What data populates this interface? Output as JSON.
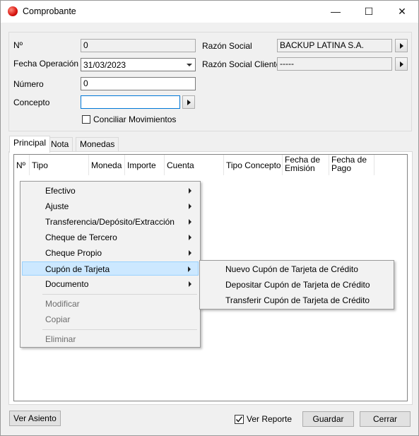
{
  "window": {
    "title": "Comprobante",
    "minimize": "—",
    "maximize": "☐",
    "close": "✕"
  },
  "form": {
    "nro_label": "Nº",
    "nro_value": "0",
    "fecha_label": "Fecha Operación",
    "fecha_value": "31/03/2023",
    "numero_label": "Número",
    "numero_value": "0",
    "concepto_label": "Concepto",
    "concepto_value": "",
    "conciliar_label": "Conciliar Movimientos",
    "conciliar_checked": false,
    "razon_label": "Razón Social",
    "razon_value": "BACKUP LATINA S.A.",
    "razon_cliente_label": "Razón Social Cliente",
    "razon_cliente_value": "-----"
  },
  "tabs": [
    {
      "label": "Principal"
    },
    {
      "label": "Nota"
    },
    {
      "label": "Monedas"
    }
  ],
  "grid": {
    "headers": [
      "Nº",
      "Tipo",
      "Moneda",
      "Importe",
      "Cuenta",
      "Tipo Concepto",
      "Fecha de Emisión",
      "Fecha de Pago"
    ]
  },
  "context_menu": {
    "items": [
      {
        "label": "Efectivo"
      },
      {
        "label": "Ajuste"
      },
      {
        "label": "Transferencia/Depósito/Extracción"
      },
      {
        "label": "Cheque de Tercero"
      },
      {
        "label": "Cheque Propio"
      },
      {
        "label": "Cupón de Tarjeta"
      },
      {
        "label": "Documento"
      }
    ],
    "disabled_items": [
      {
        "label": "Modificar"
      },
      {
        "label": "Copiar"
      },
      {
        "label": "Eliminar"
      }
    ]
  },
  "submenu": {
    "items": [
      {
        "label": "Nuevo Cupón de Tarjeta de Crédito"
      },
      {
        "label": "Depositar Cupón de Tarjeta de Crédito"
      },
      {
        "label": "Transferir Cupón de Tarjeta de Crédito"
      }
    ]
  },
  "footer": {
    "ver_asiento": "Ver Asiento",
    "ver_reporte": "Ver Reporte",
    "ver_reporte_checked": true,
    "guardar": "Guardar",
    "cerrar": "Cerrar"
  },
  "colors": {
    "accent": "#0078d7",
    "highlight": "#cce8ff",
    "app_icon": "#d8140f"
  }
}
